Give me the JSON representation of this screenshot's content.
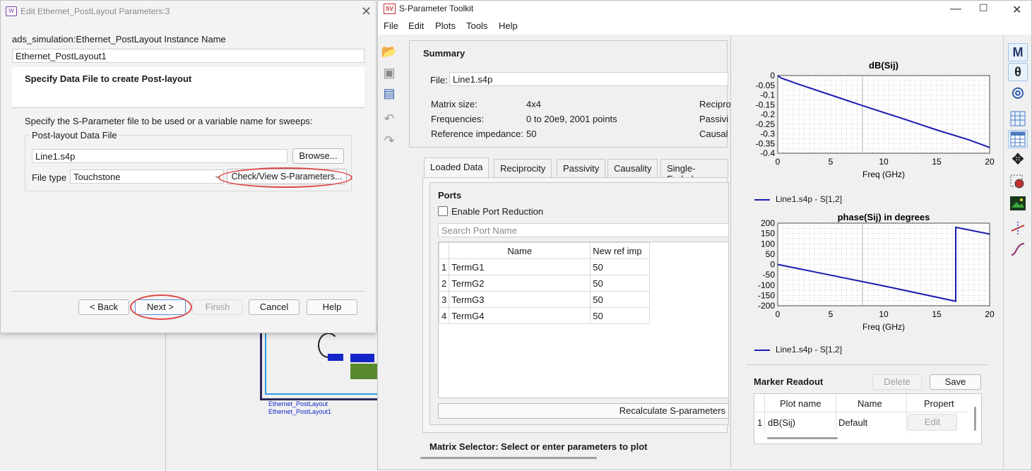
{
  "dialog": {
    "title": "Edit Ethernet_PostLayout Parameters:3",
    "instance_label": "ads_simulation:Ethernet_PostLayout Instance Name",
    "instance_value": "Ethernet_PostLayout1",
    "heading": "Specify Data File to create Post-layout",
    "description": "Specify the S-Parameter file to be used or a variable name for sweeps:",
    "group_label": "Post-layout Data File",
    "file_value": "Line1.s4p",
    "browse": "Browse...",
    "file_type_label": "File type",
    "file_type_value": "Touchstone",
    "check_view": "Check/View S-Parameters...",
    "back": "< Back",
    "next": "Next >",
    "finish": "Finish",
    "cancel": "Cancel",
    "help": "Help"
  },
  "schematic": {
    "label1": "Ethernet_PostLayout",
    "label2": "Ethernet_PostLayout1"
  },
  "toolkit": {
    "title": "S-Parameter Toolkit",
    "app_icon": "SV",
    "menu": [
      "File",
      "Edit",
      "Plots",
      "Tools",
      "Help"
    ],
    "summary": {
      "title": "Summary",
      "file_label": "File:",
      "file_value": "Line1.s4p",
      "matrix_size_label": "Matrix size:",
      "matrix_size_value": "4x4",
      "frequencies_label": "Frequencies:",
      "frequencies_value": "0 to 20e9, 2001 points",
      "ref_imp_label": "Reference impedance:",
      "ref_imp_value": "50",
      "recip": "Recipro",
      "passiv": "Passivi",
      "causal": "Causal"
    },
    "tabs": [
      "Loaded Data",
      "Reciprocity",
      "Passivity",
      "Causality",
      "Single-Ended"
    ],
    "ports": {
      "title": "Ports",
      "enable_reduction": "Enable Port Reduction",
      "search_placeholder": "Search Port Name",
      "columns": [
        "Name",
        "New ref imp"
      ],
      "rows": [
        {
          "idx": "1",
          "name": "TermG1",
          "imp": "50"
        },
        {
          "idx": "2",
          "name": "TermG2",
          "imp": "50"
        },
        {
          "idx": "3",
          "name": "TermG3",
          "imp": "50"
        },
        {
          "idx": "4",
          "name": "TermG4",
          "imp": "50"
        }
      ],
      "recalc": "Recalculate S-parameters"
    },
    "matrix_selector": "Matrix Selector: Select or enter parameters to plot",
    "marker": {
      "title": "Marker Readout",
      "delete": "Delete",
      "save": "Save",
      "columns": [
        "Plot name",
        "Name",
        "Propert"
      ],
      "row_idx": "1",
      "row_plot": "dB(Sij)",
      "row_name": "Default",
      "row_prop": "Edit"
    },
    "right_icons": [
      "M",
      "θ",
      "◎"
    ]
  },
  "chart_data": [
    {
      "type": "line",
      "title": "dB(Sij)",
      "xlabel": "Freq (GHz)",
      "ylabel": "",
      "xlim": [
        0,
        20
      ],
      "ylim": [
        -0.4,
        0
      ],
      "xticks": [
        "0",
        "5",
        "10",
        "15",
        "20"
      ],
      "yticks": [
        "0",
        "-0.05",
        "-0.1",
        "-0.15",
        "-0.2",
        "-0.25",
        "-0.3",
        "-0.35",
        "-0.4"
      ],
      "grid": true,
      "legend": "bottom-left",
      "color": "#1a1ab0",
      "series": [
        {
          "name": "Line1.s4p - S[1,2]",
          "x": [
            0,
            0.3,
            2,
            5,
            8,
            10,
            12,
            15,
            18,
            20
          ],
          "y": [
            0,
            -0.012,
            -0.045,
            -0.1,
            -0.155,
            -0.19,
            -0.225,
            -0.28,
            -0.33,
            -0.37
          ]
        }
      ]
    },
    {
      "type": "line",
      "title": "phase(Sij) in degrees",
      "xlabel": "Freq (GHz)",
      "ylabel": "",
      "xlim": [
        0,
        20
      ],
      "ylim": [
        -200,
        200
      ],
      "xticks": [
        "0",
        "5",
        "10",
        "15",
        "20"
      ],
      "yticks": [
        "200",
        "150",
        "100",
        "50",
        "0",
        "-50",
        "-100",
        "-150",
        "-200"
      ],
      "grid": true,
      "legend": "bottom-left",
      "color": "#1a1ab0",
      "series": [
        {
          "name": "Line1.s4p - S[1,2]",
          "x": [
            0,
            5,
            10,
            16.8,
            16.8,
            20
          ],
          "y": [
            0,
            -52,
            -104,
            -178,
            180,
            147
          ]
        }
      ]
    }
  ]
}
